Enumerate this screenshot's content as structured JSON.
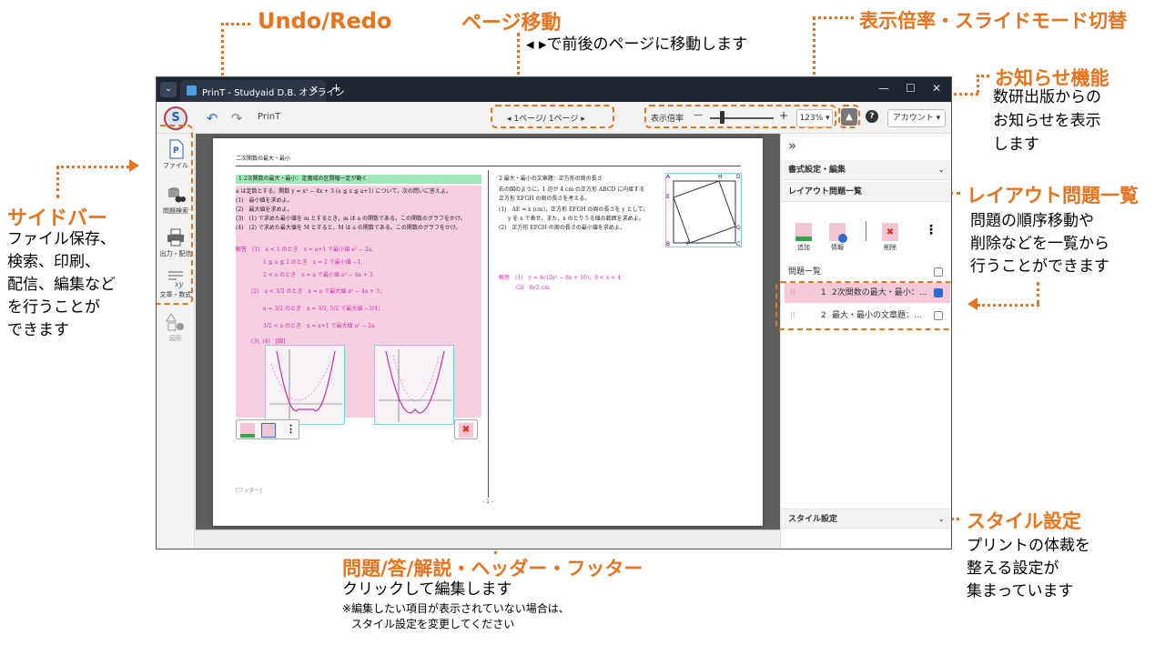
{
  "annotations": {
    "undo_redo": {
      "title": "Undo/Redo"
    },
    "page_nav": {
      "title": "ページ移動",
      "desc": "◂ ▸で前後のページに移動します"
    },
    "zoom": {
      "title": "表示倍率・スライドモード切替"
    },
    "notice": {
      "title": "お知らせ機能",
      "desc": [
        "数研出版からの",
        "お知らせを表示",
        "します"
      ]
    },
    "sidebar": {
      "title": "サイドバー",
      "desc": [
        "ファイル保存、",
        "検索、印刷、",
        "配信、編集など",
        "を行うことが",
        "できます"
      ]
    },
    "layout_list": {
      "title": "レイアウト問題一覧",
      "desc": [
        "問題の順序移動や",
        "削除などを一覧から",
        "行うことができます"
      ]
    },
    "style": {
      "title": "スタイル設定",
      "desc": [
        "プリントの体裁を",
        "整える設定が",
        "集まっています"
      ]
    },
    "edit": {
      "title": "問題/答/解説・ヘッダー・フッター",
      "desc": "クリックして編集します",
      "note1": "※編集したい項目が表示されていない場合は、",
      "note2": "スタイル設定を変更してください"
    }
  },
  "window": {
    "tab_title": "PrinT - Studyaid D.B. オンライン",
    "tab_close": "✕",
    "tab_new": "+",
    "btn_min": "—",
    "btn_max": "☐",
    "btn_close": "✕",
    "menu_glyph": "⌄"
  },
  "toolbar": {
    "avatar_letter": "S",
    "undo": "↶",
    "redo": "↷",
    "app_name": "PrinT",
    "page_nav_label": "◂ 1ページ/ 1ページ ▸",
    "zoom_label": "表示倍率",
    "zoom_minus": "—",
    "zoom_plus": "+",
    "zoom_value": "123%",
    "bell": "🔔",
    "help": "?",
    "account": "アカウント ▾"
  },
  "sidebar": {
    "items": [
      {
        "label": "ファイル",
        "icon": "file-icon"
      },
      {
        "label": "問題検索",
        "icon": "search-icon"
      },
      {
        "label": "出力・配信",
        "icon": "printer-icon"
      },
      {
        "label": "文章・数式",
        "icon": "formula-icon"
      },
      {
        "label": "図形",
        "icon": "shape-icon"
      }
    ]
  },
  "page": {
    "header_title": "二次関数の最大・最小",
    "q1_head": "1 2次関数の最大・最小：定義域の区間幅一定が動く",
    "q1_lines": [
      "a は定数とする。関数 y = x² − 4x + 3 (a ≦ x ≦ a+1) について，次の問いに答えよ。",
      "(1)　最小値を求めよ。",
      "(2)　最大値を求めよ。",
      "(3)　(1) で求めた最小値を m とするとき，m は a の関数である。この関数のグラフをかけ。",
      "(4)　(2) で求めた最大値を M とすると，M は a の関数である。この関数のグラフをかけ。"
    ],
    "q1_answers": [
      "解答　(1)　a < 1 のとき　x = a+1 で最小値 a² − 2a,",
      "1 ≦ a ≦ 2 のとき　x = 2 で最小値 −1,",
      "2 < a のとき　x = a で最小値 a² − 4a + 3",
      "(2)　a < 3/2 のとき　x = a で最大値 a² − 4a + 3；",
      "a = 3/2 のとき　x = 3/2, 5/2 で最大値 −3/4；",
      "3/2 < a のとき　x = a+1 で最大値 a² − 2a",
      "(3), (4)　[図]"
    ],
    "q2_head": "2 最大・最小の文章題：正方形の周の長さ",
    "q2_lines": [
      "右の図のように，1 辺が 4 cm の正方形 ABCD に内接する",
      "正方形 EFGH の周の長さを考える。",
      "(1)　AE = x (cm)，正方形 EFGH の周の長さを y として，",
      "y を x で表せ。また，x のとりうる値の範囲を求めよ。",
      "(2)　正方形 EFGH の周の長さの最小値を求めよ。"
    ],
    "q2_answers": [
      "解答　(1)　y = 4√(2x² − 8x + 16)，0 < x < 4",
      "(2)　8√2 cm"
    ],
    "square_labels": {
      "a": "A",
      "b": "B",
      "c": "C",
      "d": "D",
      "e": "E",
      "f": "F",
      "g": "G",
      "h": "H"
    },
    "footer": "[フッター]",
    "page_num": "- 1 -"
  },
  "rpanel": {
    "collapse": "»",
    "format_title": "書式設定・編集",
    "layout_title": "レイアウト問題一覧",
    "tools": [
      {
        "label": "追加",
        "icon": "add-icon"
      },
      {
        "label": "情報",
        "icon": "info-icon"
      },
      {
        "label": "削除",
        "icon": "delete-icon"
      }
    ],
    "more": "⋮",
    "list_header": "問題一覧",
    "rows": [
      {
        "num": "1",
        "label": "2次関数の最大・最小：...",
        "checked": true
      },
      {
        "num": "2",
        "label": "最大・最小の文章題：...",
        "checked": false
      }
    ],
    "style_title": "スタイル設定",
    "chev": "⌄"
  },
  "colors": {
    "accent": "#e8731d",
    "highlight_pink": "#f8cfe0",
    "heading_green": "#9fe8b7",
    "titlebar": "#1e2633"
  }
}
